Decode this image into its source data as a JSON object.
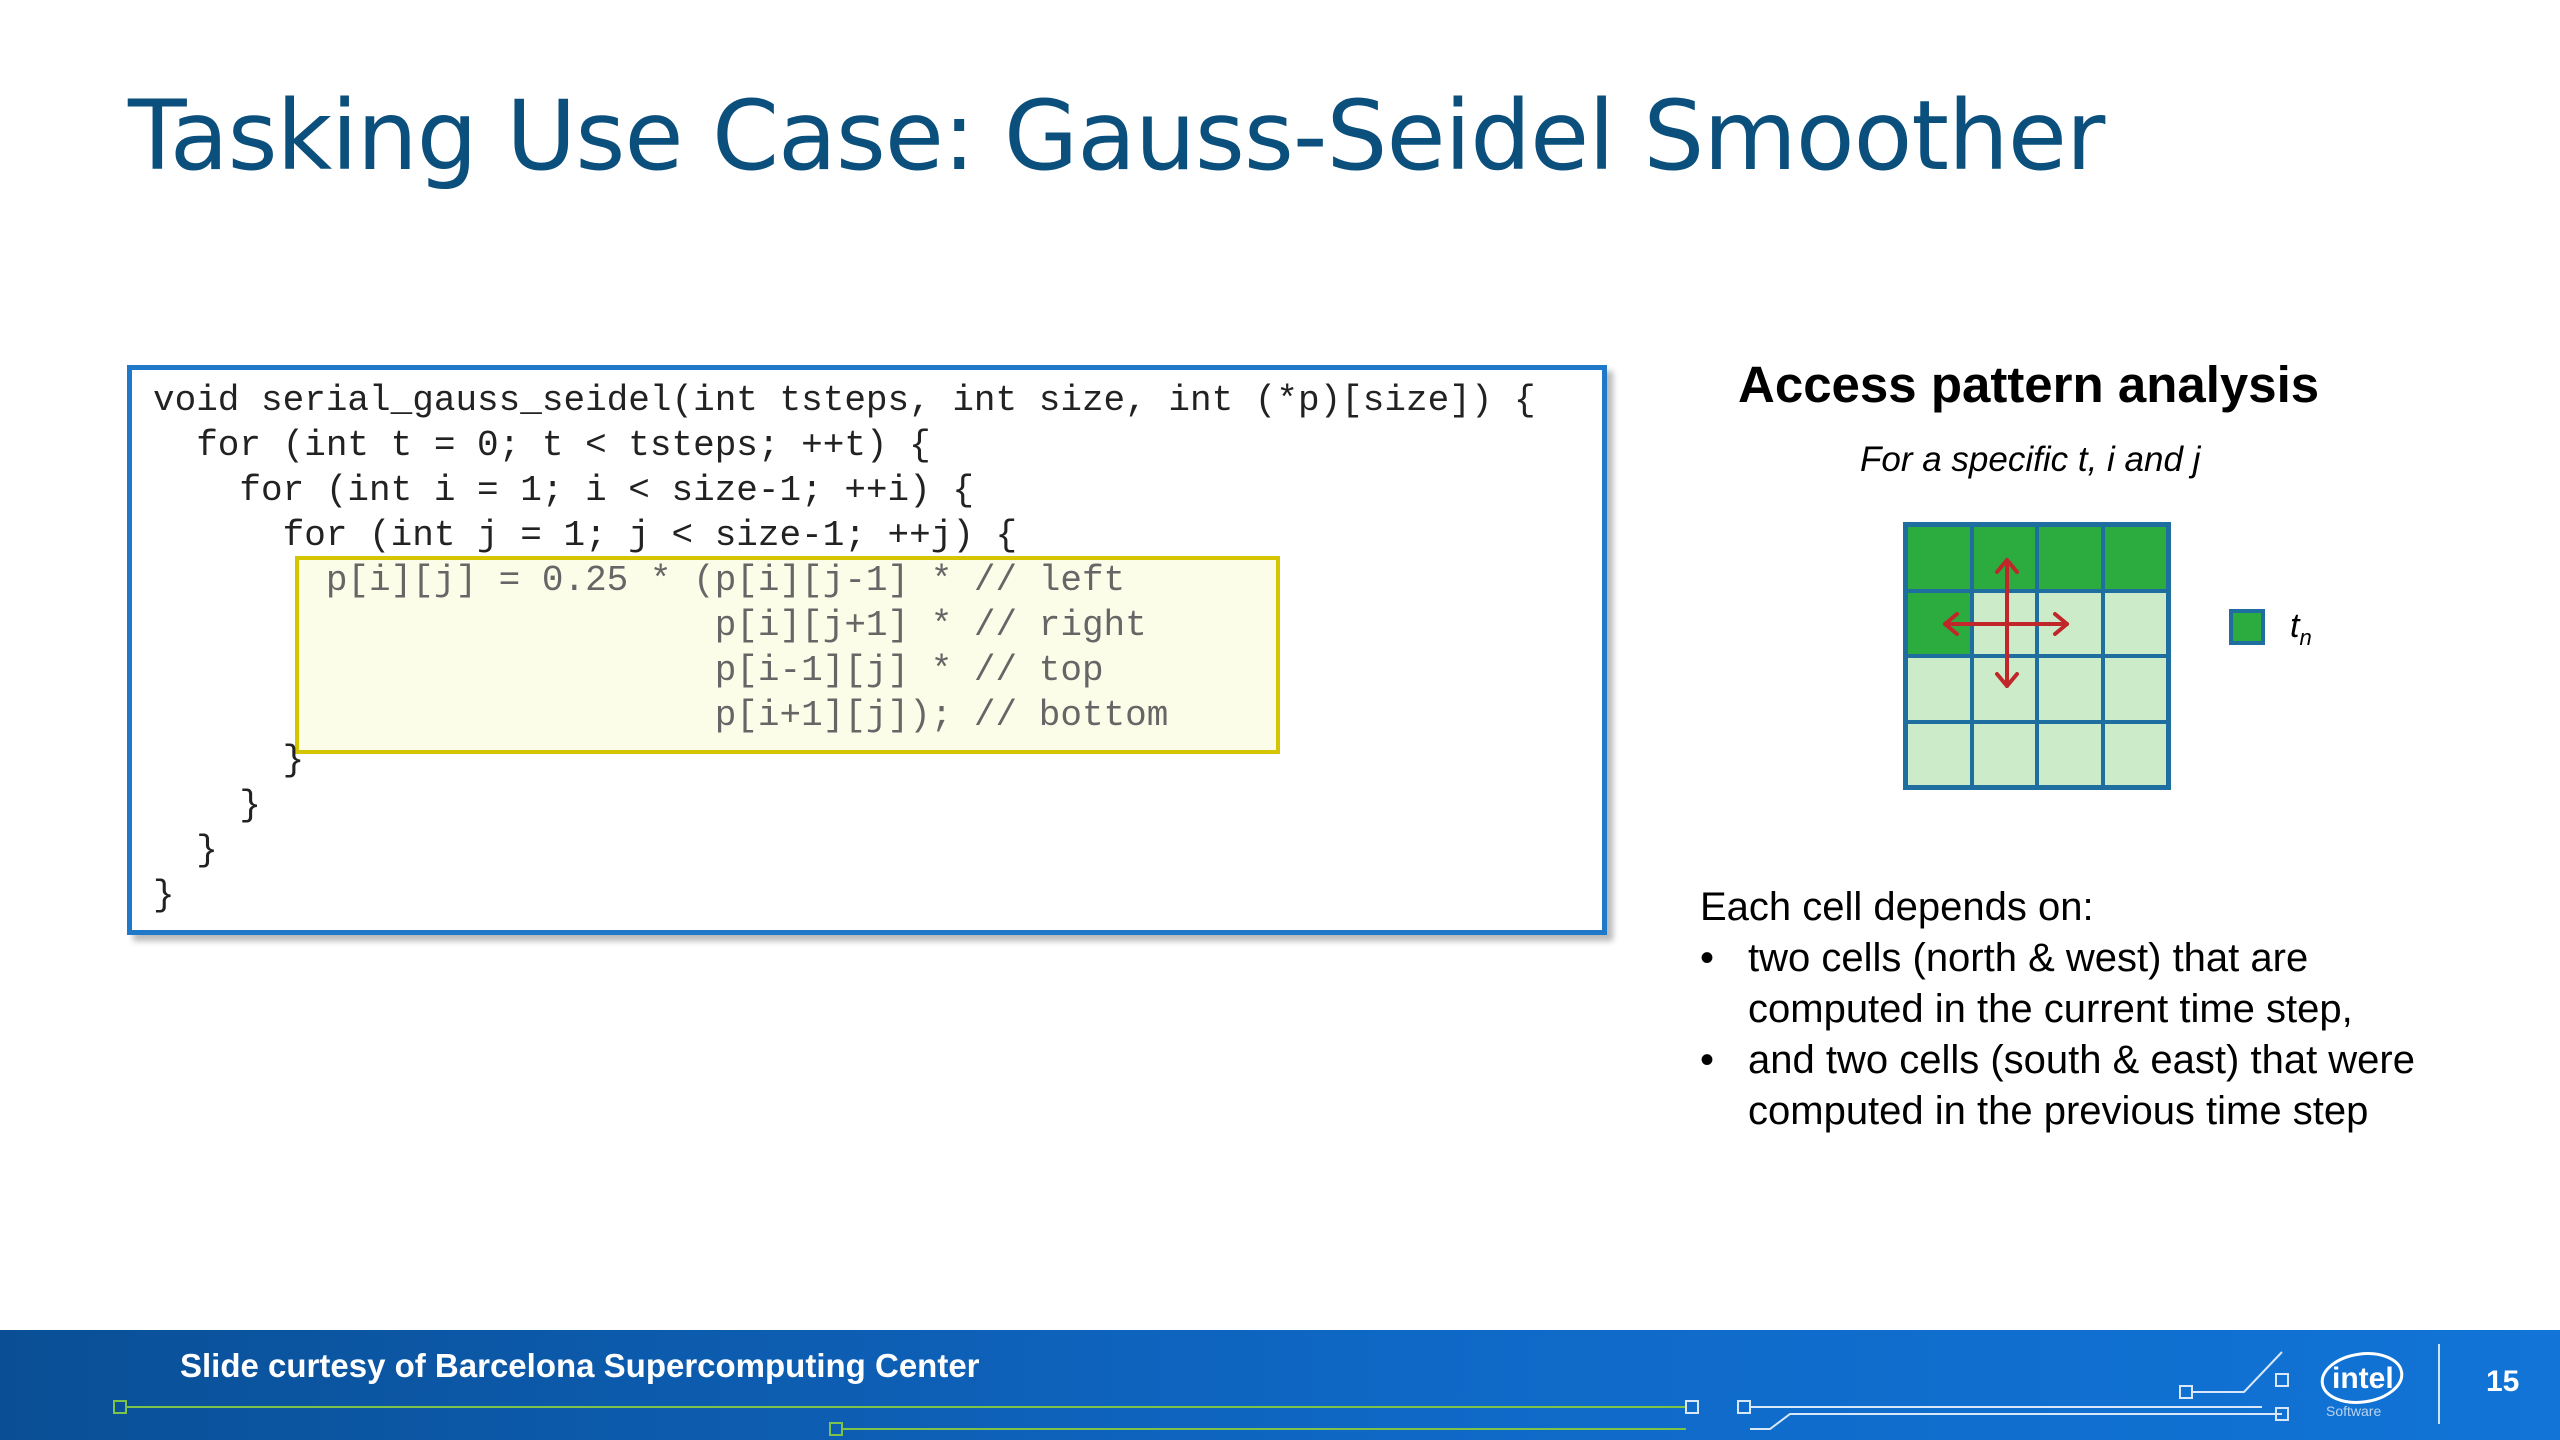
{
  "slide": {
    "title": "Tasking Use Case: Gauss-Seidel Smoother",
    "code_lines": [
      "void serial_gauss_seidel(int tsteps, int size, int (*p)[size]) {",
      "  for (int t = 0; t < tsteps; ++t) {",
      "    for (int i = 1; i < size-1; ++i) {",
      "      for (int j = 1; j < size-1; ++j) {",
      "        p[i][j] = 0.25 * (p[i][j-1] * // left",
      "                          p[i][j+1] * // right",
      "                          p[i-1][j] * // top",
      "                          p[i+1][j]); // bottom",
      "      }",
      "    }",
      "  }",
      "}"
    ],
    "access_pattern": {
      "title": "Access pattern analysis",
      "subtitle": "For a specific t, i and j",
      "legend_label": "t",
      "legend_subscript": "n",
      "cell_color_computed": "#2cab3e",
      "cell_color_pending": "#ccebc8",
      "grid_border_color": "#1e6fa0",
      "arrow_color": "#c0262a"
    },
    "description": {
      "intro": "Each cell depends on:",
      "bullets": [
        "two cells (north & west) that are computed in the current time step,",
        "and two cells (south & east) that were computed in the previous time step"
      ]
    },
    "footer": {
      "credit": "Slide curtesy of Barcelona Supercomputing Center",
      "logo_text": "intel",
      "logo_subtext": "Software",
      "page_number": "15"
    }
  }
}
